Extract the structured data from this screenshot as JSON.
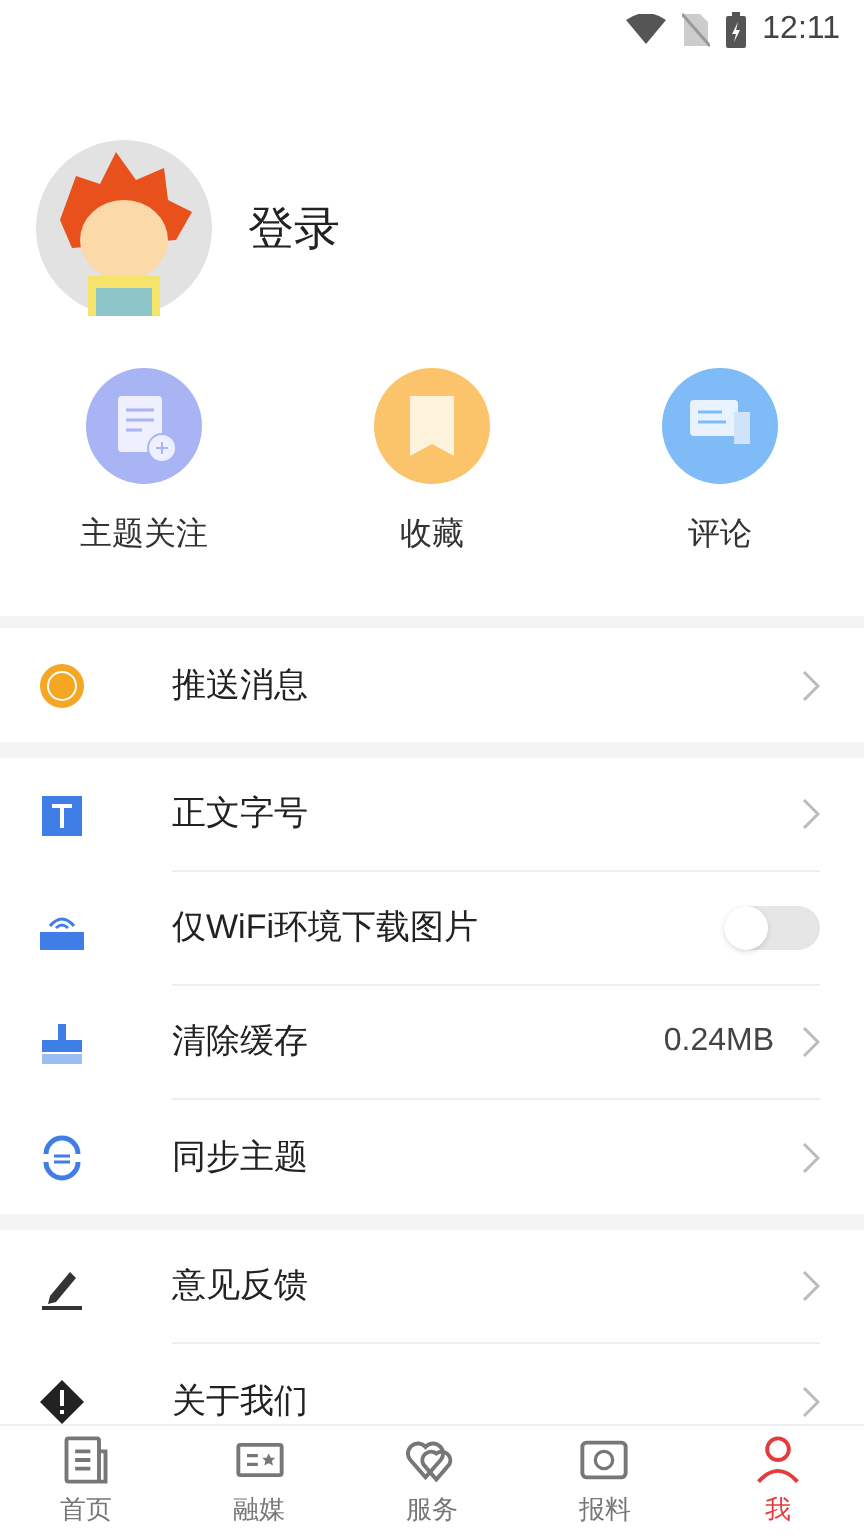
{
  "status_bar": {
    "time": "12:11"
  },
  "profile": {
    "login": "登录"
  },
  "quick_actions": [
    {
      "label": "主题关注",
      "color": "#a9b4f5"
    },
    {
      "label": "收藏",
      "color": "#fcc46a"
    },
    {
      "label": "评论",
      "color": "#7fbcf7"
    }
  ],
  "settings_groups": [
    [
      {
        "kind": "link",
        "label": "推送消息"
      }
    ],
    [
      {
        "kind": "link",
        "label": "正文字号"
      },
      {
        "kind": "toggle",
        "label": "仅WiFi环境下载图片",
        "on": false
      },
      {
        "kind": "value",
        "label": "清除缓存",
        "value": "0.24MB"
      },
      {
        "kind": "link",
        "label": "同步主题"
      }
    ],
    [
      {
        "kind": "link",
        "label": "意见反馈"
      },
      {
        "kind": "link",
        "label": "关于我们"
      }
    ]
  ],
  "bottom_nav": [
    {
      "label": "首页",
      "selected": false
    },
    {
      "label": "融媒",
      "selected": false
    },
    {
      "label": "服务",
      "selected": false
    },
    {
      "label": "报料",
      "selected": false
    },
    {
      "label": "我",
      "selected": true
    }
  ]
}
